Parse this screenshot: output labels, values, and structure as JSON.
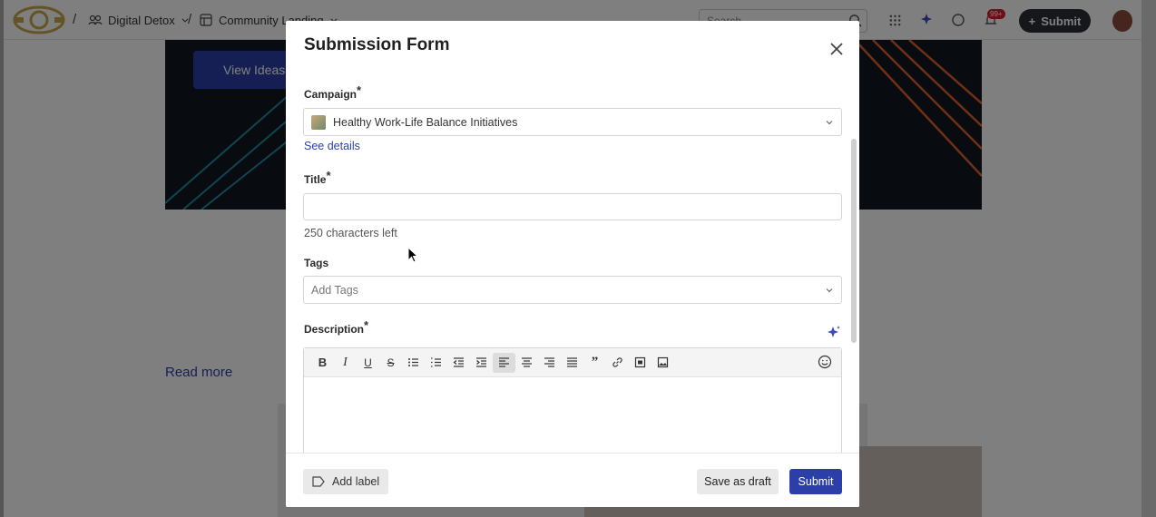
{
  "app": {
    "breadcrumb": [
      {
        "label": "Digital Detox",
        "icon": "group-icon"
      },
      {
        "label": "Community Landing",
        "icon": "page-icon"
      }
    ],
    "search_placeholder": "Search",
    "notification_badge": "99+",
    "submit_label": "Submit"
  },
  "background": {
    "view_ideas_label": "View Ideas",
    "read_more_label": "Read more"
  },
  "modal": {
    "title": "Submission Form",
    "campaign": {
      "label": "Campaign",
      "required_mark": "*",
      "value": "Healthy Work-Life Balance Initiatives",
      "see_details": "See details"
    },
    "title_field": {
      "label": "Title",
      "required_mark": "*",
      "value": "",
      "chars_left": "250 characters left"
    },
    "tags": {
      "label": "Tags",
      "placeholder": "Add Tags"
    },
    "description": {
      "label": "Description",
      "required_mark": "*",
      "toolbar": [
        "bold",
        "italic",
        "underline",
        "strikethrough",
        "bullet-list",
        "numbered-list",
        "outdent",
        "indent",
        "align-left",
        "align-center",
        "align-right",
        "justify",
        "blockquote",
        "link",
        "video",
        "image"
      ]
    },
    "footer": {
      "add_label": "Add label",
      "save_draft": "Save as draft",
      "submit": "Submit"
    }
  }
}
